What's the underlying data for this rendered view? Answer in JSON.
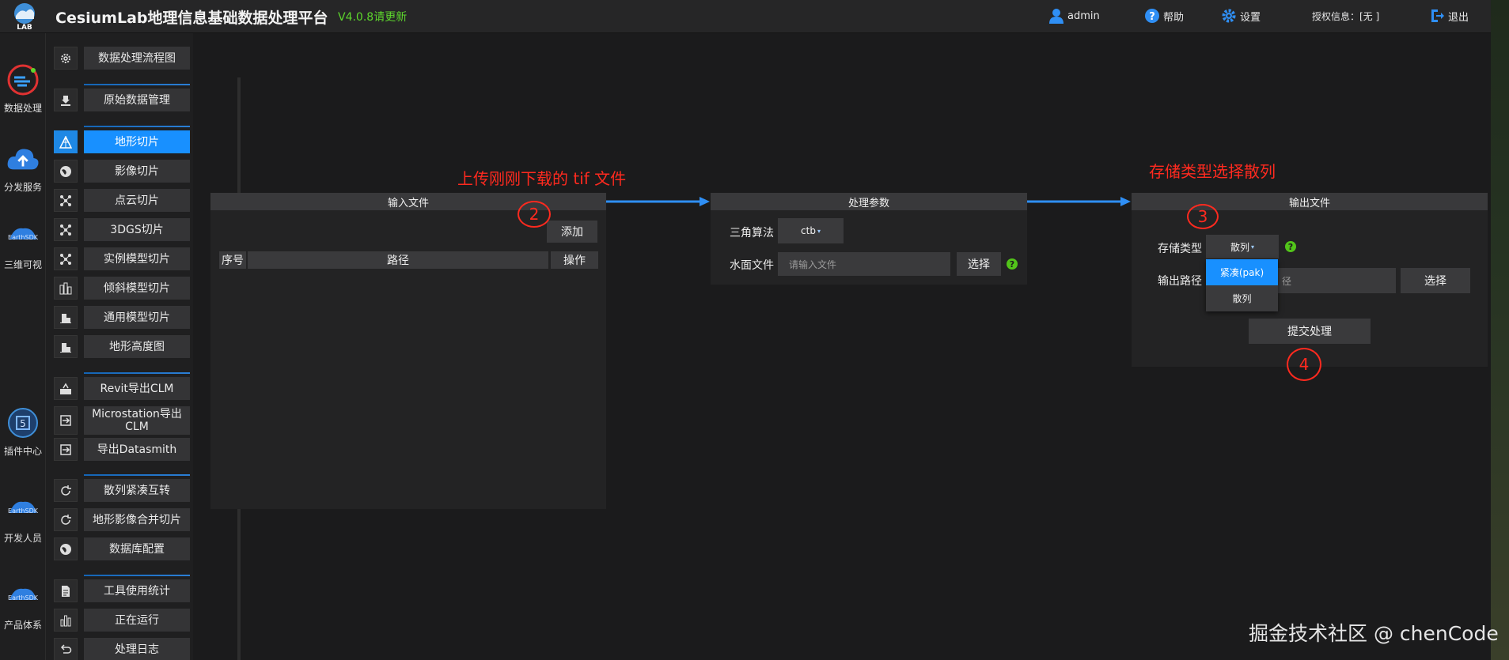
{
  "header": {
    "title": "CesiumLab地理信息基础数据处理平台",
    "version": "V4.0.8请更新",
    "user": "admin",
    "help": "帮助",
    "settings": "设置",
    "license": "授权信息：[无 ]",
    "logout": "退出",
    "logo_text": "LAB"
  },
  "rail": [
    {
      "label": "数据处理",
      "icon": "data-processing-icon"
    },
    {
      "label": "分发服务",
      "icon": "cloud-upload-icon"
    },
    {
      "label": "三维可视",
      "icon": "earthsdk-icon"
    },
    {
      "label": "插件中心",
      "icon": "plugin-icon"
    },
    {
      "label": "开发人员",
      "icon": "earthsdk-icon"
    },
    {
      "label": "产品体系",
      "icon": "earthsdk-icon"
    }
  ],
  "menu": {
    "items": [
      {
        "label": "数据处理流程图",
        "icon": "gear-icon"
      },
      {
        "label": "原始数据管理",
        "icon": "database-icon"
      },
      {
        "label": "地形切片",
        "icon": "terrain-icon",
        "active": true
      },
      {
        "label": "影像切片",
        "icon": "globe-icon"
      },
      {
        "label": "点云切片",
        "icon": "nodes-icon"
      },
      {
        "label": "3DGS切片",
        "icon": "nodes-icon"
      },
      {
        "label": "实例模型切片",
        "icon": "nodes-icon"
      },
      {
        "label": "倾斜模型切片",
        "icon": "buildings-icon"
      },
      {
        "label": "通用模型切片",
        "icon": "building-icon"
      },
      {
        "label": "地形高度图",
        "icon": "building-icon"
      },
      {
        "label": "Revit导出CLM",
        "icon": "export-icon"
      },
      {
        "label": "Microstation导出CLM",
        "icon": "export-arrow-icon"
      },
      {
        "label": "导出Datasmith",
        "icon": "export-arrow-icon"
      },
      {
        "label": "散列紧凑互转",
        "icon": "refresh-icon"
      },
      {
        "label": "地形影像合并切片",
        "icon": "refresh-icon"
      },
      {
        "label": "数据库配置",
        "icon": "globe-icon"
      },
      {
        "label": "工具使用统计",
        "icon": "document-icon"
      },
      {
        "label": "正在运行",
        "icon": "chart-icon"
      },
      {
        "label": "处理日志",
        "icon": "undo-icon"
      }
    ]
  },
  "input_panel": {
    "title": "输入文件",
    "add_button": "添加",
    "columns": [
      "序号",
      "路径",
      "操作"
    ]
  },
  "params_panel": {
    "title": "处理参数",
    "algo_label": "三角算法",
    "algo_value": "ctb",
    "water_label": "水面文件",
    "water_placeholder": "请输入文件",
    "select_button": "选择",
    "help": "?"
  },
  "output_panel": {
    "title": "输出文件",
    "storage_label": "存储类型",
    "storage_value": "散列",
    "output_label": "输出路径",
    "output_partial": "径",
    "select_button": "选择",
    "submit_button": "提交处理",
    "help": "?",
    "dropdown_options": [
      "紧凑(pak)",
      "散列"
    ]
  },
  "annotations": {
    "upload_note": "上传刚刚下载的 tif 文件",
    "storage_note": "存储类型选择散列",
    "step2": "2",
    "step3": "3",
    "step4": "4"
  },
  "watermark": "掘金技术社区 @ chenCode",
  "colors": {
    "accent": "#1890ff",
    "annotation": "#ff2a1f",
    "version": "#5dd62c",
    "help": "#52c41a"
  }
}
